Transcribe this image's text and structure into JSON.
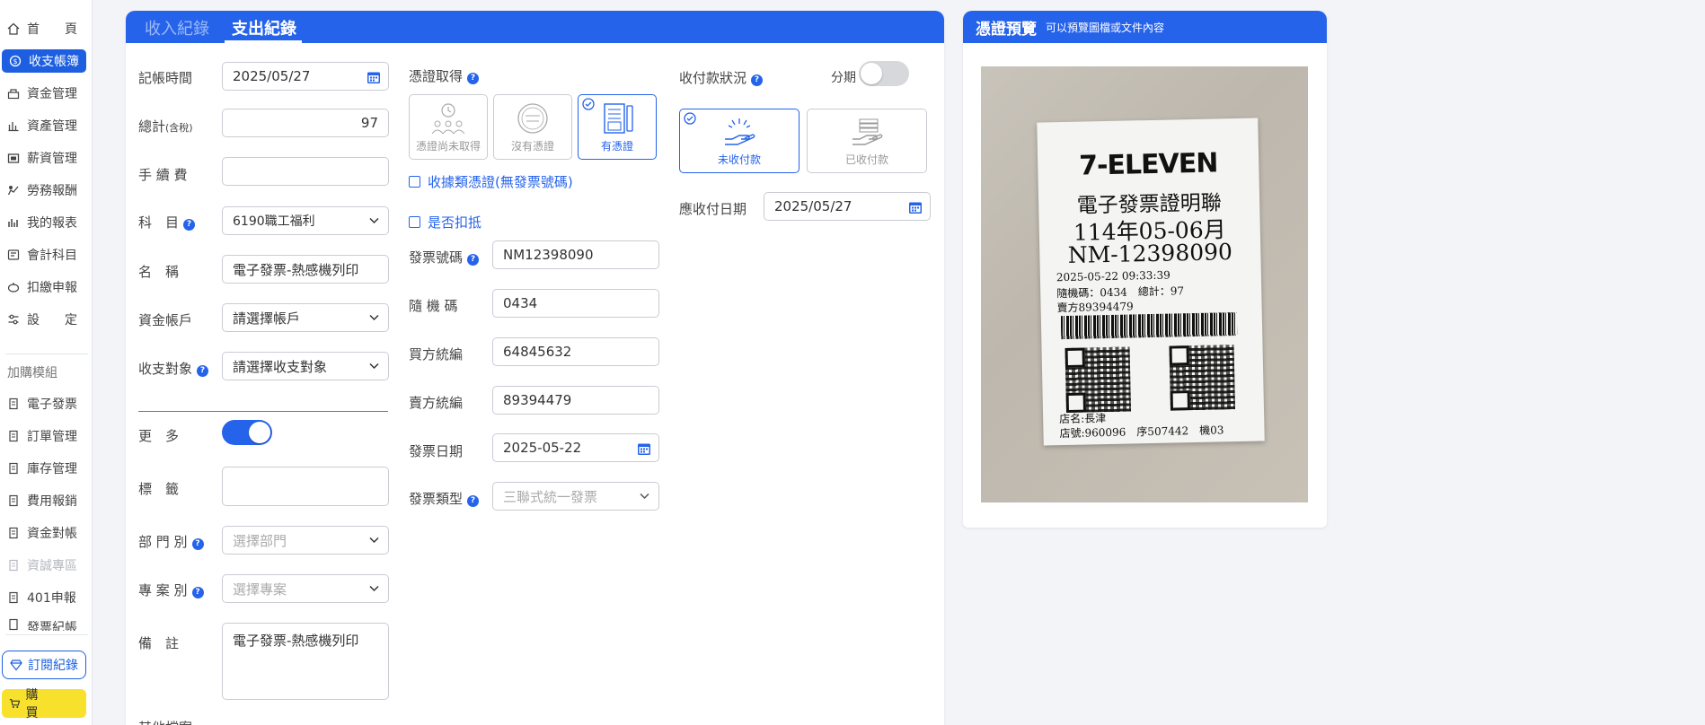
{
  "sidebar": {
    "items": [
      {
        "label": "首　　頁",
        "icon": "home-icon"
      },
      {
        "label": "收支帳簿",
        "icon": "ledger-icon"
      },
      {
        "label": "資金管理",
        "icon": "fund-icon"
      },
      {
        "label": "資產管理",
        "icon": "asset-icon"
      },
      {
        "label": "薪資管理",
        "icon": "salary-icon"
      },
      {
        "label": "勞務報酬",
        "icon": "labor-icon"
      },
      {
        "label": "我的報表",
        "icon": "report-icon"
      },
      {
        "label": "會計科目",
        "icon": "account-icon"
      },
      {
        "label": "扣繳申報",
        "icon": "withholding-icon"
      },
      {
        "label": "設　　定",
        "icon": "settings-icon"
      }
    ],
    "addon_label": "加購模組",
    "addons": [
      {
        "label": "電子發票"
      },
      {
        "label": "訂單管理"
      },
      {
        "label": "庫存管理"
      },
      {
        "label": "費用報銷"
      },
      {
        "label": "資金對帳"
      },
      {
        "label": "資誠專區"
      },
      {
        "label": "401申報"
      },
      {
        "label": "發票紀帳"
      }
    ],
    "subscription_label": "訂閱紀錄",
    "buy_label": "購買"
  },
  "tabs": {
    "income": "收入紀錄",
    "expense": "支出紀錄"
  },
  "form": {
    "date": {
      "label": "記帳時間",
      "value": "2025/05/27"
    },
    "total": {
      "label": "總計",
      "suffix": "(含稅)",
      "value": "97"
    },
    "fee": {
      "label": "手 續 費",
      "value": ""
    },
    "subject": {
      "label": "科　目",
      "value": "6190職工福利"
    },
    "name": {
      "label": "名　稱",
      "value": "電子發票-熱感機列印"
    },
    "account": {
      "label": "資金帳戶",
      "value": "請選擇帳戶"
    },
    "counterparty": {
      "label": "收支對象",
      "value": "請選擇收支對象"
    },
    "more": {
      "label": "更　多",
      "on": true
    },
    "tags": {
      "label": "標　籤",
      "value": ""
    },
    "department": {
      "label": "部 門 別",
      "placeholder": "選擇部門"
    },
    "project": {
      "label": "專 案 別",
      "placeholder": "選擇專案"
    },
    "note": {
      "label": "備　註",
      "value": "電子發票-熱感機列印"
    },
    "other_files": {
      "label": "其他檔案"
    }
  },
  "voucher": {
    "label": "憑證取得",
    "options": [
      {
        "label": "憑證尚未取得",
        "selected": false,
        "icon": "pending-voucher-icon"
      },
      {
        "label": "沒有憑證",
        "selected": false,
        "icon": "no-voucher-icon"
      },
      {
        "label": "有憑證",
        "selected": true,
        "icon": "has-voucher-icon"
      }
    ],
    "receipt_checkbox": "收據類憑證(無發票號碼)",
    "deduct_checkbox": "是否扣抵",
    "invoice_no": {
      "label": "發票號碼",
      "value": "NM12398090"
    },
    "random_code": {
      "label": "隨 機 碼",
      "value": "0434"
    },
    "buyer_id": {
      "label": "買方統編",
      "value": "64845632"
    },
    "seller_id": {
      "label": "賣方統編",
      "value": "89394479"
    },
    "invoice_date": {
      "label": "發票日期",
      "value": "2025-05-22"
    },
    "invoice_type": {
      "label": "發票類型",
      "placeholder": "三聯式統一發票"
    }
  },
  "payment": {
    "label": "收付款狀況",
    "installment_label": "分期",
    "installment_on": false,
    "options": [
      {
        "label": "未收付款",
        "selected": true,
        "icon": "unpaid-icon"
      },
      {
        "label": "已收付款",
        "selected": false,
        "icon": "paid-icon"
      }
    ],
    "due_date": {
      "label": "應收付日期",
      "value": "2025/05/27"
    }
  },
  "preview": {
    "title": "憑證預覽",
    "subtitle": "可以預覽圖檔或文件內容",
    "receipt": {
      "brand": "7-ELEVEN",
      "line1": "電子發票證明聯",
      "line2": "114年05-06月",
      "line3": "NM-12398090",
      "datetime": "2025-05-22 09:33:39",
      "random_total": "隨機碼：0434　總計：97",
      "seller": "賣方89394479",
      "store": "店名:長津",
      "store_no": "店號:960096　序507442　機03"
    }
  },
  "colors": {
    "accent": "#2563eb",
    "buy": "#f7e12c"
  }
}
